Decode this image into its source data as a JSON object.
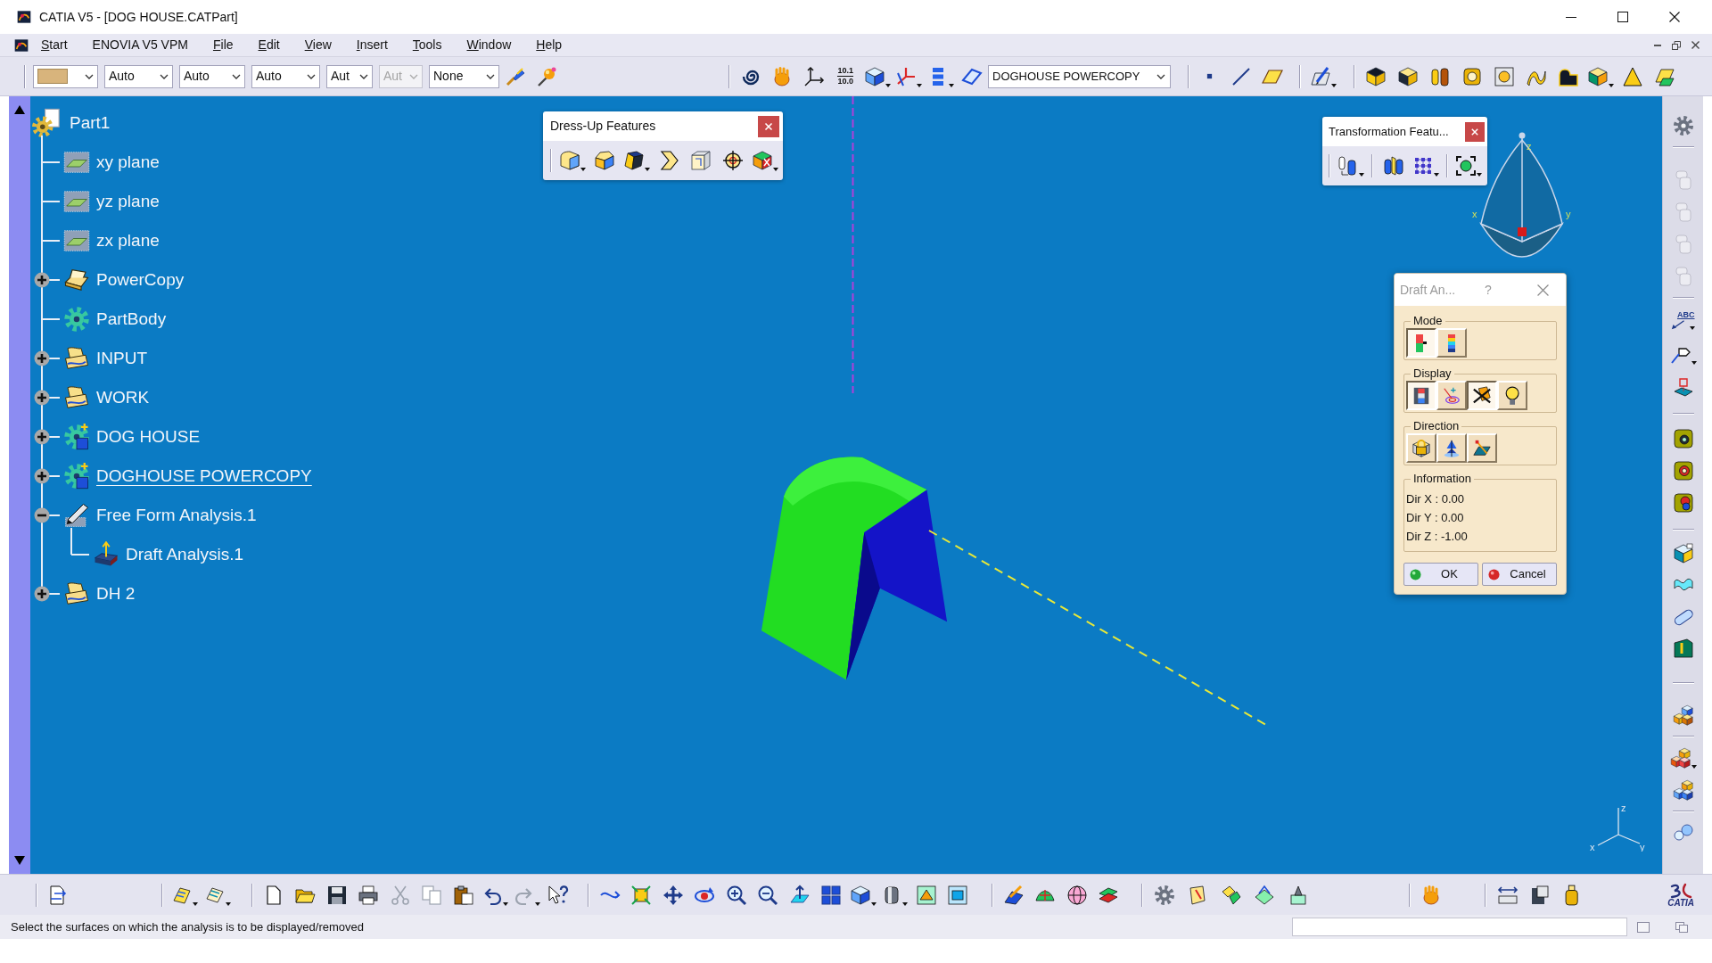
{
  "window": {
    "title": "CATIA V5 - [DOG HOUSE.CATPart]"
  },
  "menu_bar": {
    "items": [
      {
        "label": "Start",
        "mnemonic": true
      },
      {
        "label": "ENOVIA V5 VPM",
        "mnemonic": false
      },
      {
        "label": "File",
        "mnemonic": true
      },
      {
        "label": "Edit",
        "mnemonic": true
      },
      {
        "label": "View",
        "mnemonic": true
      },
      {
        "label": "Insert",
        "mnemonic": true
      },
      {
        "label": "Tools",
        "mnemonic": true
      },
      {
        "label": "Window",
        "mnemonic": true
      },
      {
        "label": "Help",
        "mnemonic": true
      }
    ]
  },
  "toolbar": {
    "properties": [
      {
        "kind": "color",
        "disabled": false
      },
      {
        "kind": "text",
        "value": "Auto",
        "disabled": false
      },
      {
        "kind": "text",
        "value": "Auto",
        "disabled": false
      },
      {
        "kind": "text",
        "value": "Auto",
        "disabled": false
      },
      {
        "kind": "text",
        "value": "Aut",
        "disabled": false
      },
      {
        "kind": "text",
        "value": "Aut",
        "disabled": true
      },
      {
        "kind": "text",
        "value": "None",
        "disabled": false
      }
    ],
    "measure_labels": [
      "10.1",
      "10.0"
    ],
    "work_object": "DOGHOUSE POWERCOPY"
  },
  "tree": {
    "root": {
      "label": "Part1",
      "kind": "part",
      "in_work": false,
      "children": [
        {
          "label": "xy plane",
          "kind": "plane",
          "in_work": false
        },
        {
          "label": "yz plane",
          "kind": "plane",
          "in_work": false
        },
        {
          "label": "zx plane",
          "kind": "plane",
          "in_work": false
        },
        {
          "label": "PowerCopy",
          "kind": "powercopy",
          "in_work": false,
          "expanded": false
        },
        {
          "label": "PartBody",
          "kind": "body",
          "in_work": false
        },
        {
          "label": "INPUT",
          "kind": "geoset",
          "in_work": false,
          "expanded": false
        },
        {
          "label": "WORK",
          "kind": "geoset",
          "in_work": false,
          "expanded": false
        },
        {
          "label": "DOG HOUSE",
          "kind": "instance",
          "in_work": false,
          "expanded": false
        },
        {
          "label": "DOGHOUSE POWERCOPY",
          "kind": "instance",
          "in_work": true,
          "expanded": false
        },
        {
          "label": "Free Form Analysis.1",
          "kind": "analysis",
          "in_work": false,
          "expanded": true,
          "children": [
            {
              "label": "Draft Analysis.1",
              "kind": "draft",
              "in_work": false
            }
          ]
        },
        {
          "label": "DH 2",
          "kind": "geoset",
          "in_work": false,
          "expanded": false
        }
      ]
    }
  },
  "dress_up_toolbar": {
    "title": "Dress-Up Features"
  },
  "transformation_toolbar": {
    "title": "Transformation Featu..."
  },
  "compass": {
    "axis_labels": [
      "x",
      "y",
      "z"
    ]
  },
  "axis_triad": {
    "axis_labels": [
      "x",
      "y",
      "z"
    ]
  },
  "draft_analysis_dialog": {
    "title": "Draft An...",
    "help": "?",
    "groups": [
      {
        "label": "Mode",
        "buttons": [
          {
            "pressed": true
          },
          {
            "pressed": false
          }
        ]
      },
      {
        "label": "Display",
        "buttons": [
          {
            "pressed": true
          },
          {
            "pressed": false
          },
          {
            "pressed": true
          },
          {
            "pressed": false
          }
        ]
      },
      {
        "label": "Direction",
        "buttons": [
          {
            "pressed": false
          },
          {
            "pressed": false
          },
          {
            "pressed": false
          }
        ]
      }
    ],
    "information": {
      "label": "Information",
      "lines": [
        "Dir X : 0.00",
        "Dir Y : 0.00",
        "Dir Z : -1.00"
      ]
    },
    "buttons": [
      {
        "kind": "ok",
        "label": "OK"
      },
      {
        "kind": "cancel",
        "label": "Cancel"
      }
    ]
  },
  "right_toolbar": {
    "annotation_label": "ABC"
  },
  "logo": {
    "text": "CATIA"
  },
  "status_bar": {
    "message": "Select the surfaces on which the analysis is to be displayed/removed"
  }
}
